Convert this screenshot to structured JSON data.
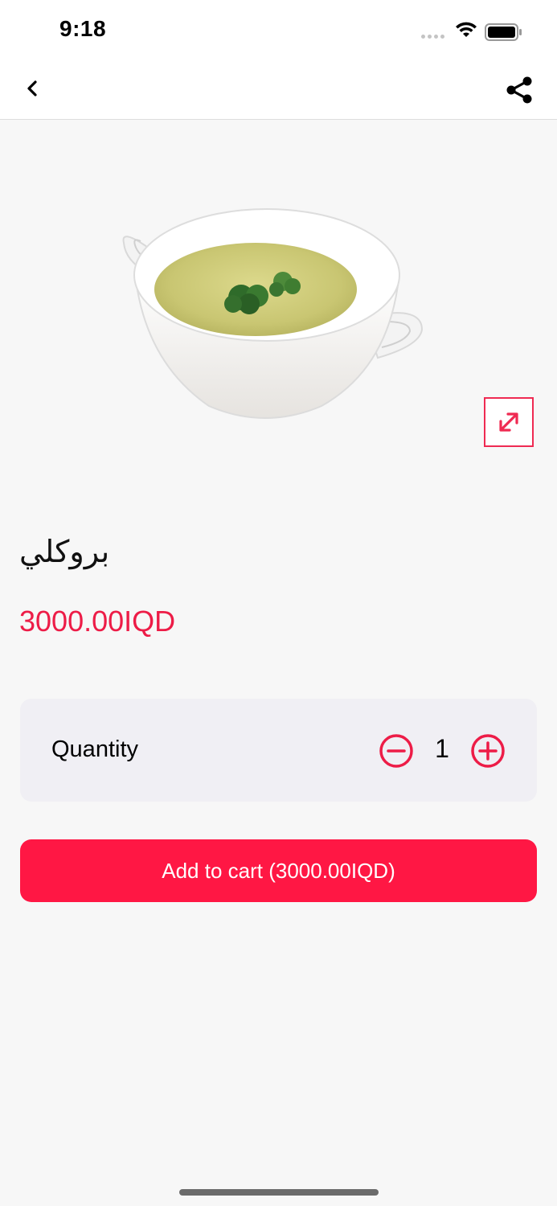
{
  "status_bar": {
    "time": "9:18"
  },
  "nav": {
    "back_icon": "chevron-left-icon",
    "share_icon": "share-icon"
  },
  "product": {
    "image_description": "bowl-of-soup",
    "name": "بروكلي",
    "price": "3000.00IQD"
  },
  "quantity": {
    "label": "Quantity",
    "value": "1"
  },
  "cart": {
    "button_label": "Add to cart (3000.00IQD)"
  },
  "colors": {
    "accent": "#ff1744",
    "price": "#ed1c47",
    "card_bg": "#f0eff4",
    "page_bg": "#f7f7f7"
  }
}
